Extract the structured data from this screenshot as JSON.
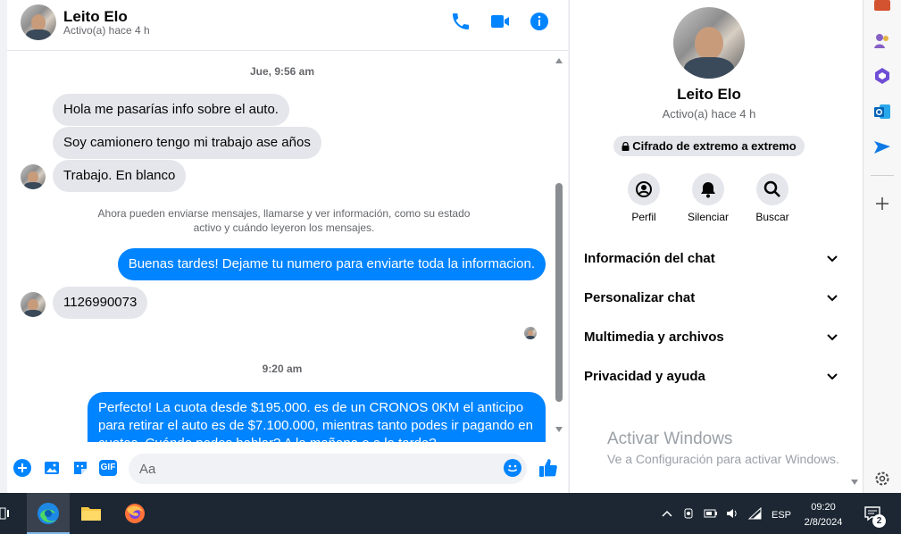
{
  "header": {
    "name": "Leito Elo",
    "status": "Activo(a) hace 4 h",
    "actions": [
      "phone-icon",
      "video-icon",
      "info-icon"
    ]
  },
  "messages": {
    "timestamp1": "Jue, 9:56 am",
    "in1": "Hola me pasarías info sobre el auto.",
    "in2": "Soy camionero tengo mi trabajo ase años",
    "in3": "Trabajo. En blanco",
    "notice_line1": "Ahora pueden enviarse mensajes, llamarse y ver información, como su estado",
    "notice_line2": "activo y cuándo leyeron los mensajes.",
    "out1": "Buenas tardes! Dejame tu numero para enviarte toda la informacion.",
    "in4": "1126990073",
    "timestamp2": "9:20 am",
    "out2_line1": "Perfecto! La cuota desde $195.000. es de un CRONOS 0KM el anticipo",
    "out2_line2": "para retirar el auto es de $7.100.000, mientras tanto podes ir pagando en",
    "out2_line3": "cuotas. Cuándo podes hablar? A la mañana o a la tarde?"
  },
  "composer": {
    "placeholder": "Aa",
    "icons": [
      "plus-icon",
      "image-icon",
      "sticker-icon",
      "gif-icon",
      "emoji-icon",
      "like-icon"
    ],
    "gif_label": "GIF"
  },
  "info_panel": {
    "name": "Leito Elo",
    "status": "Activo(a) hace 4 h",
    "encryption": "Cifrado de extremo a extremo",
    "quick_actions": {
      "profile": "Perfil",
      "mute": "Silenciar",
      "search": "Buscar"
    },
    "sections": [
      "Información del chat",
      "Personalizar chat",
      "Multimedia y archivos",
      "Privacidad y ayuda"
    ],
    "watermark_title": "Activar Windows",
    "watermark_sub": "Ve a Configuración para activar Windows."
  },
  "taskbar": {
    "language": "ESP",
    "time": "09:20",
    "date": "2/8/2024",
    "notification_count": "2"
  },
  "colors": {
    "accent": "#0084ff",
    "incoming_bubble": "#e4e6eb",
    "taskbar": "#1c2733"
  }
}
